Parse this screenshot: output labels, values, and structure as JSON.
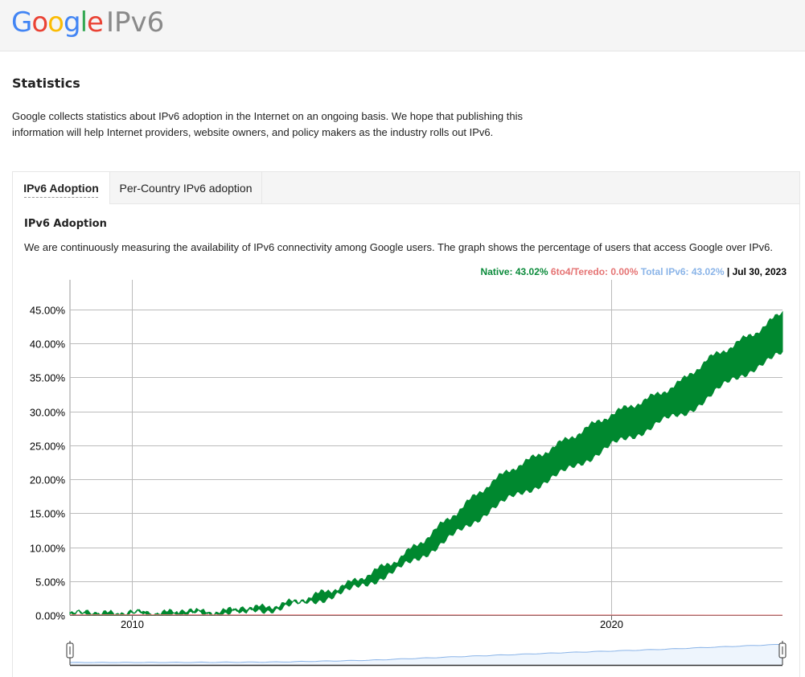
{
  "header": {
    "logo": {
      "g1": "G",
      "o1": "o",
      "o2": "o",
      "g2": "g",
      "l": "l",
      "e": "e"
    },
    "product": "IPv6"
  },
  "page": {
    "title": "Statistics",
    "intro": "Google collects statistics about IPv6 adoption in the Internet on an ongoing basis. We hope that publishing this information will help Internet providers, website owners, and policy makers as the industry rolls out IPv6."
  },
  "tabs": [
    {
      "label": "IPv6 Adoption",
      "active": true
    },
    {
      "label": "Per-Country IPv6 adoption",
      "active": false
    }
  ],
  "section": {
    "title": "IPv6 Adoption",
    "description": "We are continuously measuring the availability of IPv6 connectivity among Google users. The graph shows the percentage of users that access Google over IPv6."
  },
  "legend": {
    "native": "Native: 43.02%",
    "teredo": "6to4/Teredo: 0.00%",
    "total": "Total IPv6: 43.02%",
    "separator": " | ",
    "date": "Jul 30, 2023"
  },
  "colors": {
    "native": "#00882f",
    "teredo": "#e57373",
    "total": "#8ab4e8",
    "grid": "#bbbbbb"
  },
  "chart_data": {
    "type": "area",
    "title": "",
    "xlabel": "",
    "ylabel": "",
    "xlim": [
      2008.7,
      2023.58
    ],
    "ylim": [
      0,
      45
    ],
    "x_ticks": [
      {
        "value": 2010,
        "label": "2010"
      },
      {
        "value": 2020,
        "label": "2020"
      }
    ],
    "y_ticks": [
      {
        "value": 0,
        "label": "0.00%"
      },
      {
        "value": 5,
        "label": "5.00%"
      },
      {
        "value": 10,
        "label": "10.00%"
      },
      {
        "value": 15,
        "label": "15.00%"
      },
      {
        "value": 20,
        "label": "20.00%"
      },
      {
        "value": 25,
        "label": "25.00%"
      },
      {
        "value": 30,
        "label": "30.00%"
      },
      {
        "value": 35,
        "label": "35.00%"
      },
      {
        "value": 40,
        "label": "40.00%"
      },
      {
        "value": 45,
        "label": "45.00%"
      }
    ],
    "grid": true,
    "series": [
      {
        "name": "Native",
        "x": [
          2008.7,
          2009.5,
          2010.0,
          2010.5,
          2011.0,
          2011.5,
          2012.0,
          2012.5,
          2013.0,
          2013.5,
          2014.0,
          2014.5,
          2015.0,
          2015.5,
          2016.0,
          2016.5,
          2017.0,
          2017.5,
          2018.0,
          2018.5,
          2019.0,
          2019.5,
          2020.0,
          2020.5,
          2021.0,
          2021.5,
          2022.0,
          2022.5,
          2023.0,
          2023.58
        ],
        "low": [
          0.1,
          0.12,
          0.15,
          0.18,
          0.22,
          0.3,
          0.4,
          0.65,
          1.0,
          1.6,
          2.5,
          3.5,
          5.0,
          6.5,
          8.5,
          10.8,
          13.0,
          15.8,
          17.5,
          19.3,
          21.0,
          23.0,
          25.0,
          26.5,
          28.5,
          29.5,
          32.0,
          34.5,
          36.5,
          38.5
        ],
        "high": [
          0.15,
          0.18,
          0.22,
          0.28,
          0.35,
          0.45,
          0.6,
          0.9,
          1.4,
          2.1,
          3.3,
          4.5,
          6.2,
          8.0,
          10.5,
          13.5,
          16.5,
          19.5,
          21.8,
          23.5,
          25.5,
          27.5,
          29.5,
          31.0,
          32.5,
          34.5,
          37.5,
          39.5,
          41.5,
          44.5
        ]
      },
      {
        "name": "6to4/Teredo",
        "x": [
          2008.7,
          2012.0,
          2014.0,
          2016.0,
          2018.0,
          2023.58
        ],
        "values": [
          0.05,
          0.04,
          0.03,
          0.02,
          0.01,
          0.0
        ]
      }
    ],
    "navigator": {
      "x": [
        2008.7,
        2011.0,
        2013.0,
        2015.0,
        2017.0,
        2019.0,
        2021.0,
        2023.58
      ],
      "values": [
        0.1,
        0.3,
        1.2,
        5.5,
        14.5,
        23.0,
        30.5,
        42.5
      ]
    }
  }
}
